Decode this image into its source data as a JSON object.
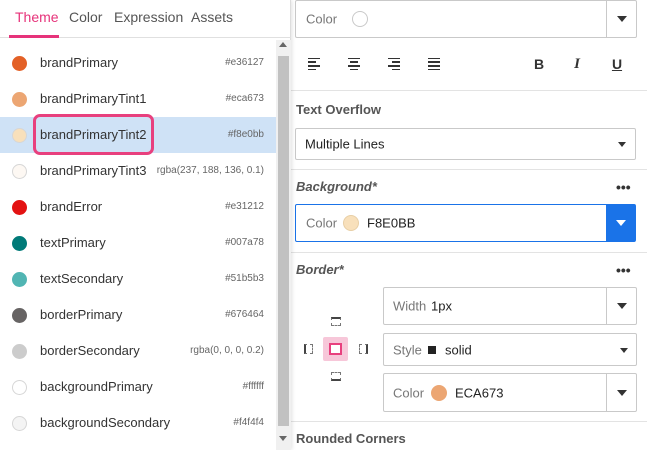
{
  "popover": {
    "tabs": [
      {
        "label": "Theme"
      },
      {
        "label": "Color"
      },
      {
        "label": "Expression"
      },
      {
        "label": "Assets"
      }
    ],
    "active_tab": "Theme",
    "theme_colors": [
      {
        "name": "brandPrimary",
        "value": "#e36127",
        "swatch": "#e36127"
      },
      {
        "name": "brandPrimaryTint1",
        "value": "#eca673",
        "swatch": "#eca673"
      },
      {
        "name": "brandPrimaryTint2",
        "value": "#f8e0bb",
        "swatch": "#f8e0bb"
      },
      {
        "name": "brandPrimaryTint3",
        "value": "rgba(237, 188, 136, 0.1)",
        "swatch": "#fdf8f3"
      },
      {
        "name": "brandError",
        "value": "#e31212",
        "swatch": "#e31212"
      },
      {
        "name": "textPrimary",
        "value": "#007a78",
        "swatch": "#007a78"
      },
      {
        "name": "textSecondary",
        "value": "#51b5b3",
        "swatch": "#51b5b3"
      },
      {
        "name": "borderPrimary",
        "value": "#676464",
        "swatch": "#676464"
      },
      {
        "name": "borderSecondary",
        "value": "rgba(0, 0, 0, 0.2)",
        "swatch": "#cccccc"
      },
      {
        "name": "backgroundPrimary",
        "value": "#ffffff",
        "swatch": "#ffffff"
      },
      {
        "name": "backgroundSecondary",
        "value": "#f4f4f4",
        "swatch": "#f4f4f4"
      }
    ],
    "selected_index": 2
  },
  "props": {
    "color_field": {
      "label": "Color"
    },
    "text_overflow": {
      "title": "Text Overflow",
      "value": "Multiple Lines"
    },
    "background": {
      "title": "Background*",
      "label": "Color",
      "value": "F8E0BB",
      "swatch": "#f8e0bb"
    },
    "border": {
      "title": "Border*",
      "width_label": "Width",
      "width_value": "1px",
      "style_label": "Style",
      "style_value": "solid",
      "color_label": "Color",
      "color_value": "ECA673",
      "color_swatch": "#eca673"
    },
    "rounded": {
      "title": "Rounded Corners"
    },
    "more_label": "•••"
  },
  "colors": {
    "accent": "#e6337a",
    "selected_row": "#cfe2f6",
    "dropdown_active": "#1a73e8"
  }
}
